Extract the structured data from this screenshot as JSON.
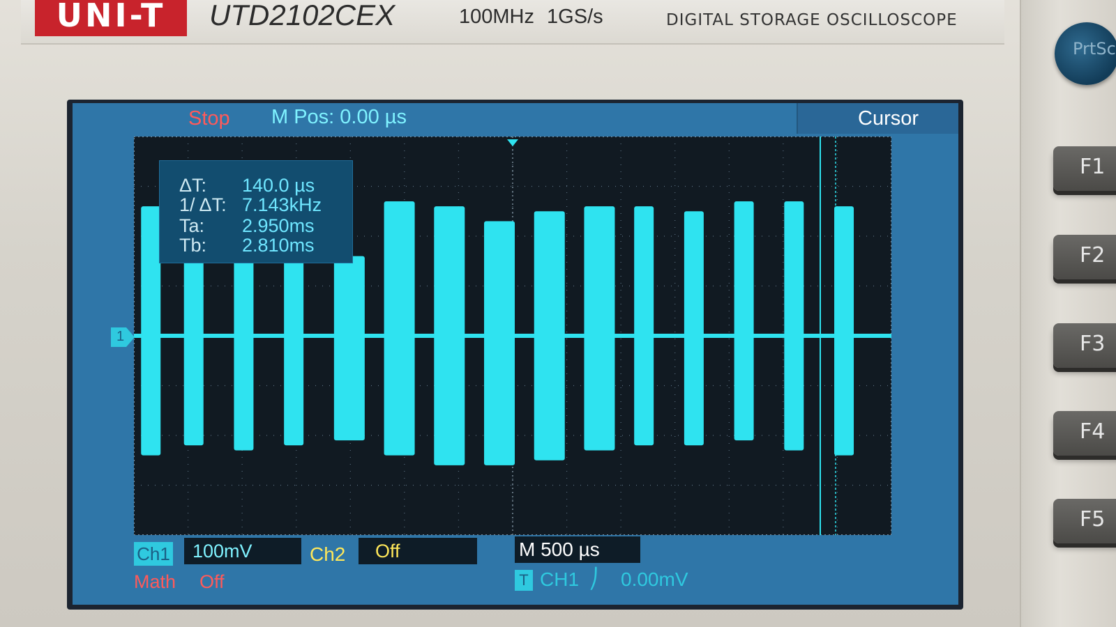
{
  "instrument": {
    "brand": "UNI-T",
    "model": "UTD2102CEX",
    "specs": "100MHz  1GS/s",
    "product": "DIGITAL STORAGE OSCILLOSCOPE",
    "prtsc_label": "PrtSc",
    "fkeys": [
      "F1",
      "F2",
      "F3",
      "F4",
      "F5"
    ]
  },
  "status": {
    "run_state": "Stop",
    "m_pos": "M Pos: 0.00 µs",
    "menu_title": "Cursor"
  },
  "cursor_readout": {
    "rows": [
      {
        "label": "ΔT:",
        "value": "140.0 µs"
      },
      {
        "label": "1/ ΔT:",
        "value": "7.143kHz"
      },
      {
        "label": "Ta:",
        "value": "2.950ms"
      },
      {
        "label": "Tb:",
        "value": "2.810ms"
      }
    ]
  },
  "channels": {
    "ch1_label": "Ch1",
    "ch1_scale": "100mV",
    "ch1_marker": "1",
    "ch2_label": "Ch2",
    "ch2_state": "Off",
    "math_label": "Math",
    "math_state": "Off"
  },
  "timebase": {
    "scale": "M 500 µs"
  },
  "trigger": {
    "icon": "T",
    "source": "CH1",
    "edge": "rising-edge-icon",
    "edge_glyph": "⎠",
    "level": "0.00mV"
  },
  "colors": {
    "ch1": "#2fe3f0",
    "screen_bg": "#2f76a8",
    "plot_bg": "#111a22",
    "run_state": "#ff5a5a",
    "ch2": "#ffe85a"
  },
  "waveform": {
    "description_units": "divisions",
    "baseline_div": 0,
    "bursts": [
      {
        "t": 0.1,
        "hi": 2.6,
        "lo": -2.4
      },
      {
        "t": 0.7,
        "hi": 1.6,
        "lo": -2.2
      },
      {
        "t": 1.4,
        "hi": 1.6,
        "lo": -2.3
      },
      {
        "t": 2.1,
        "hi": 1.6,
        "lo": -2.2
      },
      {
        "t": 2.8,
        "hi": 1.6,
        "lo": -2.1
      },
      {
        "t": 3.5,
        "hi": 2.7,
        "lo": -2.4
      },
      {
        "t": 4.2,
        "hi": 2.6,
        "lo": -2.6
      },
      {
        "t": 4.9,
        "hi": 2.3,
        "lo": -2.6
      },
      {
        "t": 5.6,
        "hi": 2.5,
        "lo": -2.5
      },
      {
        "t": 6.3,
        "hi": 2.6,
        "lo": -2.3
      },
      {
        "t": 7.0,
        "hi": 2.6,
        "lo": -2.2
      },
      {
        "t": 7.7,
        "hi": 2.5,
        "lo": -2.2
      },
      {
        "t": 8.4,
        "hi": 2.7,
        "lo": -2.1
      },
      {
        "t": 9.1,
        "hi": 2.7,
        "lo": -2.3
      },
      {
        "t": 9.8,
        "hi": 2.6,
        "lo": -2.4
      }
    ]
  }
}
